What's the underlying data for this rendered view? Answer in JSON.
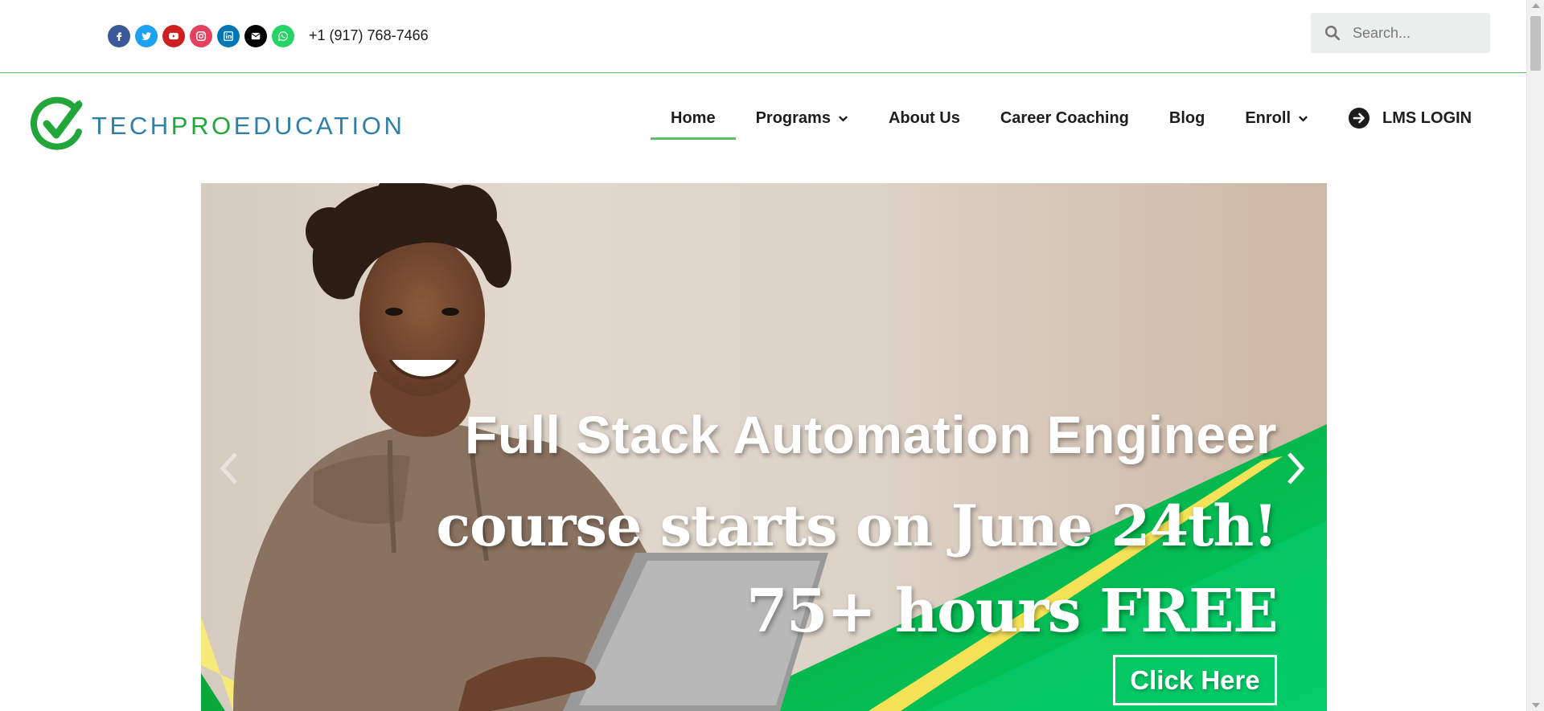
{
  "topbar": {
    "social": [
      {
        "icon": "facebook-icon",
        "color": "#3b5998"
      },
      {
        "icon": "twitter-icon",
        "color": "#1da1f2"
      },
      {
        "icon": "youtube-icon",
        "color": "#cd201f"
      },
      {
        "icon": "instagram-icon",
        "color": "#e4405f"
      },
      {
        "icon": "linkedin-icon",
        "color": "#0077b5"
      },
      {
        "icon": "envelope-icon",
        "color": "#000000"
      },
      {
        "icon": "whatsapp-icon",
        "color": "#25d366"
      }
    ],
    "phone": "+1 (917) 768-7466",
    "search_placeholder": "Search..."
  },
  "logo": {
    "part1": "TECH",
    "part2": "PRO",
    "part3": "EDUCATION"
  },
  "nav": {
    "items": [
      {
        "label": "Home",
        "active": true
      },
      {
        "label": "Programs",
        "dropdown": true
      },
      {
        "label": "About Us"
      },
      {
        "label": "Career Coaching"
      },
      {
        "label": "Blog"
      },
      {
        "label": "Enroll",
        "dropdown": true
      }
    ],
    "lms_label": "LMS LOGIN"
  },
  "hero": {
    "line1": "Full Stack Automation Engineer",
    "line2": "course starts on June 24th!",
    "line3": "75+ hours FREE",
    "cta_label": "Click Here"
  },
  "colors": {
    "accent_green": "#5cc06a",
    "brand_blue": "#2f7fa8",
    "brand_green": "#22a63a",
    "hero_green": "#0db14b"
  }
}
